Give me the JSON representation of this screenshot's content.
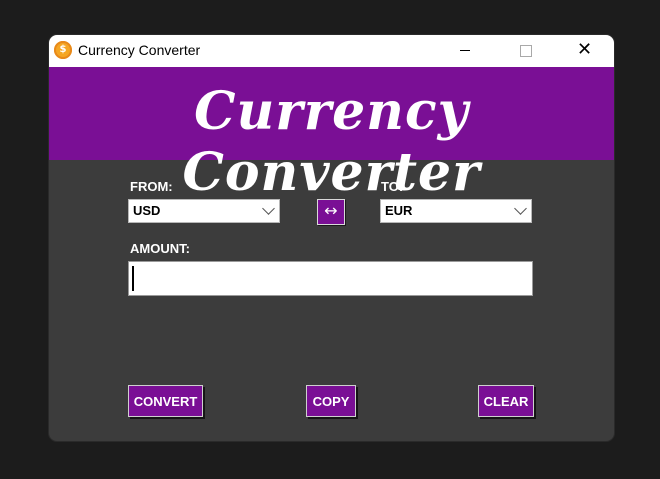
{
  "window": {
    "title": "Currency Converter",
    "app_icon": "coin-icon",
    "controls": {
      "minimize": "minimize-icon",
      "maximize": "maximize-icon",
      "close": "close-icon"
    }
  },
  "banner": {
    "text": "Currency Converter",
    "color": "#7a0f95"
  },
  "form": {
    "from_label": "FROM:",
    "from_value": "USD",
    "to_label": "TO:",
    "to_value": "EUR",
    "swap_symbol": "↔",
    "amount_label": "AMOUNT:",
    "amount_value": ""
  },
  "actions": {
    "convert": "CONVERT",
    "copy": "COPY",
    "clear": "CLEAR"
  },
  "colors": {
    "accent": "#7a0f95",
    "body_bg": "#3c3c3c"
  }
}
